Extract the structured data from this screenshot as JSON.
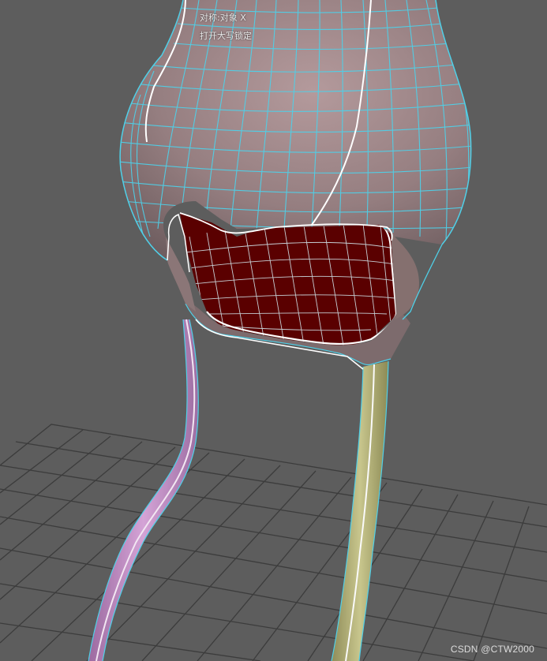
{
  "viewport": {
    "background_color": "#5d5d5d",
    "grid_color": "#3c3c3c",
    "mesh_wire_color": "#4fd0e8",
    "mesh_surface_color": "#9a8486",
    "mesh_inner_color": "#5a0000",
    "seam_color": "#ffffff",
    "left_leg_color": "#c696c8",
    "right_leg_color": "#b9b77e"
  },
  "hud": {
    "symmetry_label": "对称:对象 X",
    "caps_lock_label": "打开大写锁定"
  },
  "watermark": {
    "text": "CSDN @CTW2000"
  }
}
